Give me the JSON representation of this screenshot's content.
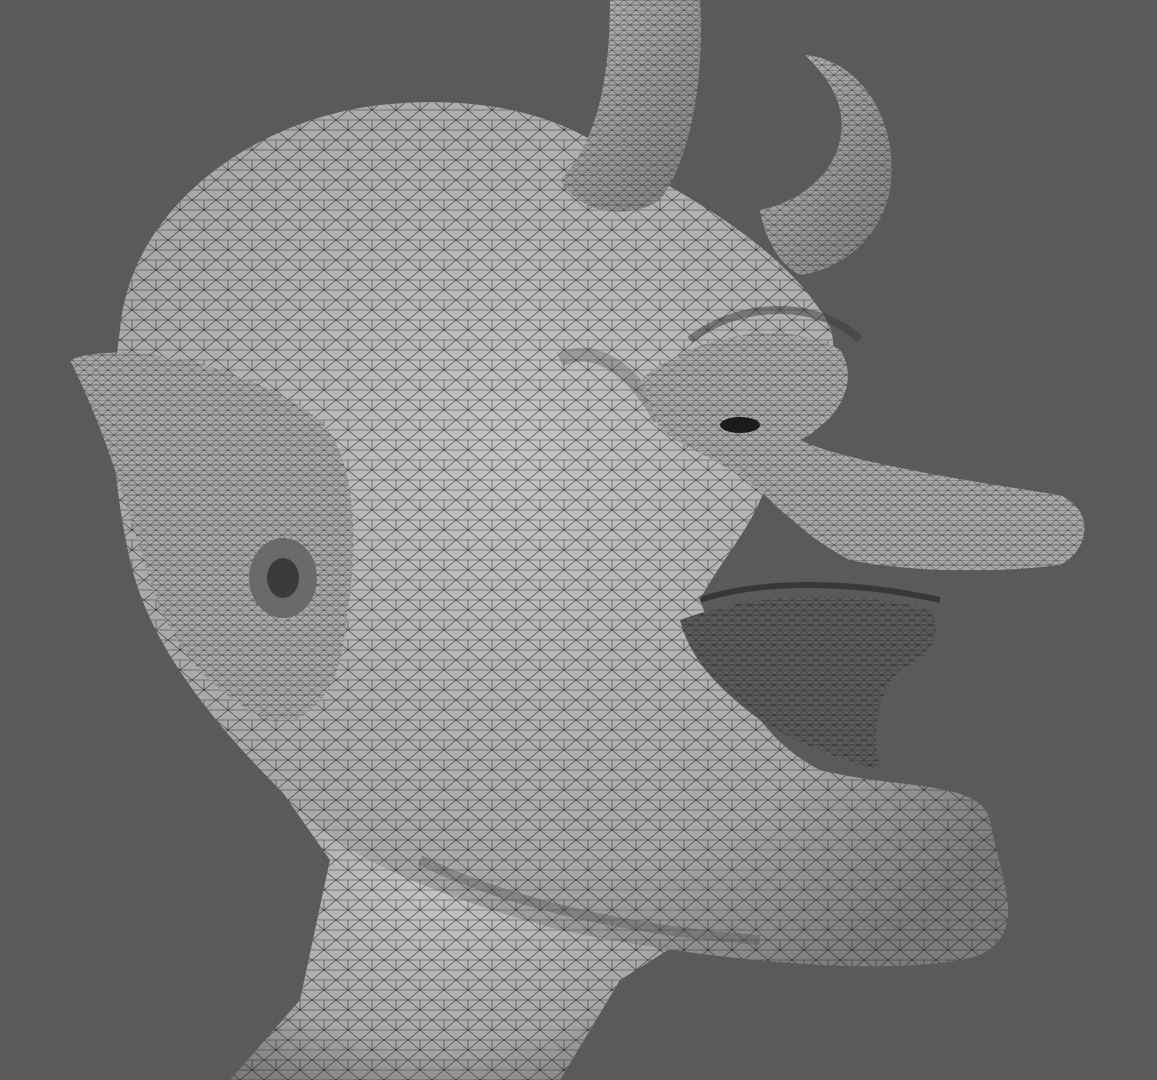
{
  "scene": {
    "subject": "wireframe-mesh-bust",
    "background_color": "#5a5a5a",
    "surface_color": "#b4b4b4",
    "wire_color": "#1e1e1e",
    "shade_color": "#6e6e6e",
    "view": "perspective"
  }
}
